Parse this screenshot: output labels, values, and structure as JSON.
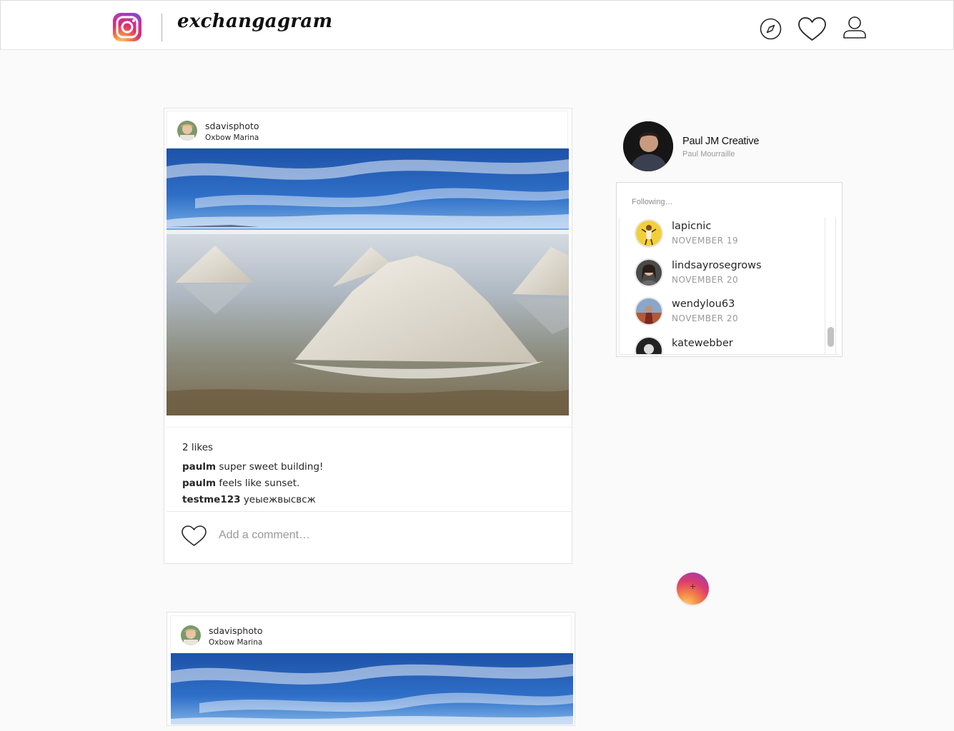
{
  "app": {
    "wordmark": "exchangagram"
  },
  "header": {
    "icons": [
      "instagram-logo-icon",
      "compass-icon",
      "heart-icon",
      "user-icon"
    ]
  },
  "posts": [
    {
      "username": "sdavisphoto",
      "location": "Oxbow Marina",
      "likes": "2 likes",
      "comments": [
        {
          "user": "paulm",
          "text": "super sweet building!"
        },
        {
          "user": "paulm",
          "text": "feels like sunset."
        },
        {
          "user": "testme123",
          "text": "уеыежвысвсж"
        }
      ],
      "comment_placeholder": "Add a comment…"
    },
    {
      "username": "sdavisphoto",
      "location": "Oxbow Marina"
    }
  ],
  "profile": {
    "name": "Paul JM Creative",
    "subname": "Paul Mourraille"
  },
  "following": {
    "title": "Following…",
    "items": [
      {
        "name": "lapicnic",
        "date": "NOVEMBER 19"
      },
      {
        "name": "lindsayrosegrows",
        "date": "NOVEMBER 20"
      },
      {
        "name": "wendylou63",
        "date": "NOVEMBER 20"
      },
      {
        "name": "katewebber",
        "date": ""
      }
    ]
  },
  "fab": {
    "label": "+"
  },
  "colors": {
    "background": "#fafafa",
    "border": "#dbdbdb",
    "text": "#262626",
    "muted": "#999999",
    "fab_gradient": [
      "#fdd27a",
      "#f58a45",
      "#dc3b6d",
      "#8b3ec2"
    ]
  }
}
